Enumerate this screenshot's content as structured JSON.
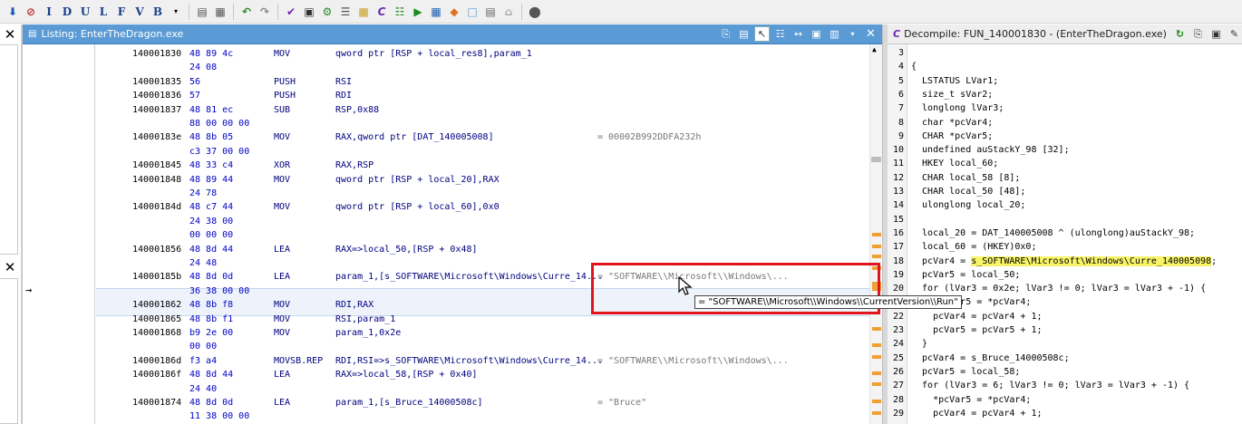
{
  "toolbar": {
    "letters": [
      "I",
      "D",
      "U",
      "L",
      "F",
      "V",
      "B"
    ]
  },
  "listing": {
    "title": "Listing:  EnterTheDragon.exe",
    "rows": [
      {
        "addr": "140001830",
        "bytes": "48 89 4c",
        "mnem": "MOV",
        "opnd": "qword ptr [RSP + local_res8],param_1",
        "cmt": ""
      },
      {
        "addr": "",
        "bytes": "24 08",
        "mnem": "",
        "opnd": "",
        "cmt": ""
      },
      {
        "addr": "140001835",
        "bytes": "56",
        "mnem": "PUSH",
        "opnd": "RSI",
        "cmt": ""
      },
      {
        "addr": "140001836",
        "bytes": "57",
        "mnem": "PUSH",
        "opnd": "RDI",
        "cmt": ""
      },
      {
        "addr": "140001837",
        "bytes": "48 81 ec",
        "mnem": "SUB",
        "opnd": "RSP,0x88",
        "cmt": ""
      },
      {
        "addr": "",
        "bytes": "88 00 00 00",
        "mnem": "",
        "opnd": "",
        "cmt": ""
      },
      {
        "addr": "14000183e",
        "bytes": "48 8b 05",
        "mnem": "MOV",
        "opnd": "RAX,qword ptr [DAT_140005008]",
        "cmt": "= 00002B992DDFA232h"
      },
      {
        "addr": "",
        "bytes": "c3 37 00 00",
        "mnem": "",
        "opnd": "",
        "cmt": ""
      },
      {
        "addr": "140001845",
        "bytes": "48 33 c4",
        "mnem": "XOR",
        "opnd": "RAX,RSP",
        "cmt": ""
      },
      {
        "addr": "140001848",
        "bytes": "48 89 44",
        "mnem": "MOV",
        "opnd": "qword ptr [RSP + local_20],RAX",
        "cmt": ""
      },
      {
        "addr": "",
        "bytes": "24 78",
        "mnem": "",
        "opnd": "",
        "cmt": ""
      },
      {
        "addr": "14000184d",
        "bytes": "48 c7 44",
        "mnem": "MOV",
        "opnd": "qword ptr [RSP + local_60],0x0",
        "cmt": ""
      },
      {
        "addr": "",
        "bytes": "24 38 00",
        "mnem": "",
        "opnd": "",
        "cmt": ""
      },
      {
        "addr": "",
        "bytes": "00 00 00",
        "mnem": "",
        "opnd": "",
        "cmt": ""
      },
      {
        "addr": "140001856",
        "bytes": "48 8d 44",
        "mnem": "LEA",
        "opnd": "RAX=>local_50,[RSP + 0x48]",
        "cmt": ""
      },
      {
        "addr": "",
        "bytes": "24 48",
        "mnem": "",
        "opnd": "",
        "cmt": ""
      },
      {
        "addr": "14000185b",
        "bytes": "48 8d 0d",
        "mnem": "LEA",
        "opnd": "param_1,[s_SOFTWARE\\Microsoft\\Windows\\Curre_14...",
        "cmt": "= \"SOFTWARE\\\\Microsoft\\\\Windows\\..."
      },
      {
        "addr": "",
        "bytes": "36 38 00 00",
        "mnem": "",
        "opnd": "",
        "cmt": ""
      },
      {
        "addr": "140001862",
        "bytes": "48 8b f8",
        "mnem": "MOV",
        "opnd": "RDI,RAX",
        "cmt": ""
      },
      {
        "addr": "140001865",
        "bytes": "48 8b f1",
        "mnem": "MOV",
        "opnd": "RSI,param_1",
        "cmt": ""
      },
      {
        "addr": "140001868",
        "bytes": "b9 2e 00",
        "mnem": "MOV",
        "opnd": "param_1,0x2e",
        "cmt": ""
      },
      {
        "addr": "",
        "bytes": "00 00",
        "mnem": "",
        "opnd": "",
        "cmt": ""
      },
      {
        "addr": "14000186d",
        "bytes": "f3 a4",
        "mnem": "MOVSB.REP",
        "opnd": "RDI,RSI=>s_SOFTWARE\\Microsoft\\Windows\\Curre_14...",
        "cmt": "= \"SOFTWARE\\\\Microsoft\\\\Windows\\..."
      },
      {
        "addr": "14000186f",
        "bytes": "48 8d 44",
        "mnem": "LEA",
        "opnd": "RAX=>local_58,[RSP + 0x40]",
        "cmt": ""
      },
      {
        "addr": "",
        "bytes": "24 40",
        "mnem": "",
        "opnd": "",
        "cmt": ""
      },
      {
        "addr": "140001874",
        "bytes": "48 8d 0d",
        "mnem": "LEA",
        "opnd": "param_1,[s_Bruce_14000508c]",
        "cmt": "= \"Bruce\""
      },
      {
        "addr": "",
        "bytes": "11 38 00 00",
        "mnem": "",
        "opnd": "",
        "cmt": ""
      }
    ]
  },
  "decompile": {
    "title": "Decompile: FUN_140001830 -  (EnterTheDragon.exe)",
    "lines": [
      {
        "n": "3",
        "t": ""
      },
      {
        "n": "4",
        "t": "{"
      },
      {
        "n": "5",
        "t": "  LSTATUS LVar1;"
      },
      {
        "n": "6",
        "t": "  size_t sVar2;"
      },
      {
        "n": "7",
        "t": "  longlong lVar3;"
      },
      {
        "n": "8",
        "t": "  char *pcVar4;"
      },
      {
        "n": "9",
        "t": "  CHAR *pcVar5;"
      },
      {
        "n": "10",
        "t": "  undefined auStackY_98 [32];"
      },
      {
        "n": "11",
        "t": "  HKEY local_60;"
      },
      {
        "n": "12",
        "t": "  CHAR local_58 [8];"
      },
      {
        "n": "13",
        "t": "  CHAR local_50 [48];"
      },
      {
        "n": "14",
        "t": "  ulonglong local_20;"
      },
      {
        "n": "15",
        "t": ""
      },
      {
        "n": "16",
        "t": "  local_20 = DAT_140005008 ^ (ulonglong)auStackY_98;"
      },
      {
        "n": "17",
        "t": "  local_60 = (HKEY)0x0;"
      },
      {
        "n": "18",
        "t": "  pcVar4 = s_SOFTWARE\\Microsoft\\Windows\\Curre_140005098;"
      },
      {
        "n": "19",
        "t": "  pcVar5 = local_50;"
      },
      {
        "n": "20",
        "t": "  for (lVar3 = 0x2e; lVar3 != 0; lVar3 = lVar3 + -1) {"
      },
      {
        "n": "21",
        "t": "    *pcVar5 = *pcVar4;"
      },
      {
        "n": "22",
        "t": "    pcVar4 = pcVar4 + 1;"
      },
      {
        "n": "23",
        "t": "    pcVar5 = pcVar5 + 1;"
      },
      {
        "n": "24",
        "t": "  }"
      },
      {
        "n": "25",
        "t": "  pcVar4 = s_Bruce_14000508c;"
      },
      {
        "n": "26",
        "t": "  pcVar5 = local_58;"
      },
      {
        "n": "27",
        "t": "  for (lVar3 = 6; lVar3 != 0; lVar3 = lVar3 + -1) {"
      },
      {
        "n": "28",
        "t": "    *pcVar5 = *pcVar4;"
      },
      {
        "n": "29",
        "t": "    pcVar4 = pcVar4 + 1;"
      }
    ]
  },
  "tooltip": {
    "text": "= \"SOFTWARE\\\\Microsoft\\\\Windows\\\\CurrentVersion\\\\Run\""
  },
  "colors": {
    "title_active": "#5b9bd5",
    "highlight_var": "#f8f46a",
    "annotation_box": "#e0141a"
  }
}
